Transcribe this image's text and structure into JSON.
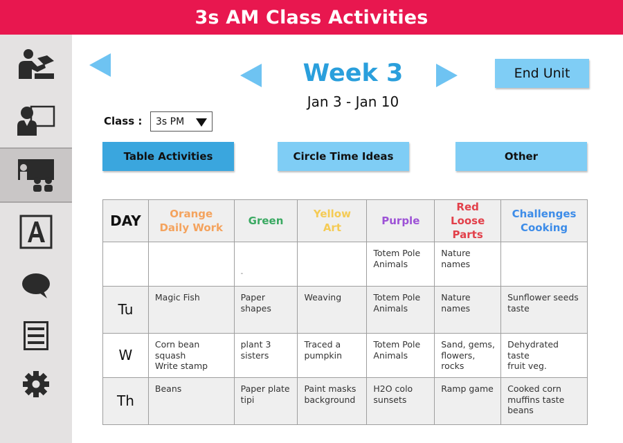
{
  "header": {
    "title": "3s AM Class Activities"
  },
  "sidebar": {
    "items": [
      {
        "icon": "teacher-reading-icon"
      },
      {
        "icon": "teacher-board-icon"
      },
      {
        "icon": "classroom-icon",
        "active": true
      },
      {
        "icon": "letter-a-icon"
      },
      {
        "icon": "chat-bubble-icon"
      },
      {
        "icon": "list-icon"
      },
      {
        "icon": "gear-icon"
      }
    ]
  },
  "nav": {
    "week_title": "Week 3",
    "week_dates": "Jan 3 - Jan 10",
    "end_unit_label": "End Unit"
  },
  "class_filter": {
    "label": "Class :",
    "selected": "3s PM"
  },
  "tabs": [
    {
      "label": "Table Activities",
      "active": true
    },
    {
      "label": "Circle Time Ideas",
      "active": false
    },
    {
      "label": "Other",
      "active": false
    }
  ],
  "table": {
    "columns": [
      {
        "line1": "DAY",
        "line2": "",
        "color": "#111111"
      },
      {
        "line1": "Orange",
        "line2": "Daily Work",
        "color": "#f4a35e"
      },
      {
        "line1": "Green",
        "line2": "",
        "color": "#3aa962"
      },
      {
        "line1": "Yellow",
        "line2": "Art",
        "color": "#f5cb55"
      },
      {
        "line1": "Purple",
        "line2": "",
        "color": "#9d52d6"
      },
      {
        "line1": "Red",
        "line2": "Loose Parts",
        "color": "#e2404a"
      },
      {
        "line1": "Challenges",
        "line2": "Cooking",
        "color": "#3d8ce8"
      }
    ],
    "rows": [
      {
        "day": "",
        "cells": [
          "",
          "-",
          "",
          "Totem Pole\nAnimals",
          "Nature\nnames",
          ""
        ]
      },
      {
        "day": "Tu",
        "cells": [
          "Magic Fish",
          "Paper\nshapes",
          "Weaving",
          "Totem Pole\nAnimals",
          "Nature\nnames",
          "Sunflower seeds\ntaste"
        ]
      },
      {
        "day": "W",
        "cells": [
          "Corn bean\nsquash\nWrite stamp",
          "plant 3\nsisters",
          "Traced a\npumpkin",
          "Totem Pole\nAnimals",
          "Sand, gems,\nflowers,\nrocks",
          "Dehydrated taste\nfruit veg."
        ]
      },
      {
        "day": "Th",
        "cells": [
          "Beans",
          "Paper plate\ntipi",
          "Paint masks\nbackground",
          "H2O colo\nsunsets",
          "Ramp game",
          "Cooked corn\nmuffins taste\nbeans"
        ]
      }
    ]
  }
}
